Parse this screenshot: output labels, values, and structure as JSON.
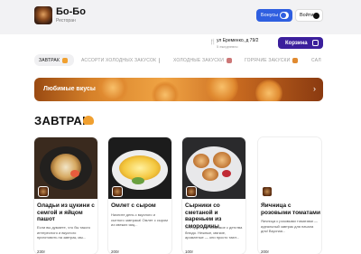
{
  "header": {
    "brand": "Бо-Бо",
    "subtitle": "Ресторан",
    "bonus_label": "Бонусы",
    "login_label": "Войти"
  },
  "delivery": {
    "address": "ул Еременко, д 79/2",
    "time": "5 ежедневно",
    "cart_label": "Корзина"
  },
  "tabs": [
    "ЗАВТРАК",
    "АССОРТИ ХОЛОДНЫХ ЗАКУСОК",
    "ХОЛОДНЫЕ ЗАКУСКИ",
    "ГОРЯЧИЕ ЗАКУСКИ",
    "САЛ"
  ],
  "banner": {
    "title": "Любимые вкусы"
  },
  "section": {
    "title": "ЗАВТРАК"
  },
  "products": [
    {
      "name": "Оладьи из цукини с семгой и яйцом пашот",
      "desc": "Если вы думаете, что бы такого интересного и вкусного приготовить на завтрак, мы...",
      "price": "230г"
    },
    {
      "name": "Омлет с сыром",
      "desc": "Начните день с вкусного и сытного завтрака! Омлет с сыром из свежих яиц...",
      "price": "200г"
    },
    {
      "name": "Сырники со сметаной и вареньем из смородины",
      "desc": "Это простое и знакомое с детства блюдо. Нежные, мягкие, ароматные — они просто тают...",
      "price": "100г"
    },
    {
      "name": "Яичница с розовыми томатами",
      "desc": "Яичница с розовыми томатами — идеальный завтрак для начала дня! Вкусная...",
      "price": "200г"
    }
  ],
  "colors": {
    "accent": "#2f5fe0",
    "cart": "#3b1f9c"
  }
}
